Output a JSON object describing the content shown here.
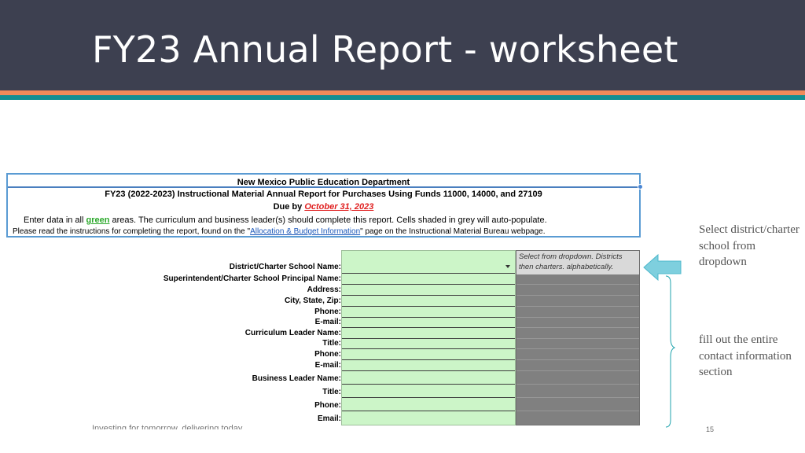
{
  "slide": {
    "title": "FY23 Annual Report - worksheet",
    "footer": "Investing for tomorrow, delivering today.",
    "page_number": "15"
  },
  "sheet": {
    "org": "New Mexico Public Education Department",
    "report_title": "FY23 (2022-2023) Instructional Material Annual Report for Purchases Using Funds 11000, 14000, and 27109",
    "due_prefix": "Due by ",
    "due_date": "October 31, 2023",
    "instr_pre": "Enter data in all ",
    "instr_green": "green",
    "instr_post": " areas.  The curriculum and business leader(s) should complete this report.  Cells shaded in grey will auto-populate.",
    "read_pre": "Please read the instructions for completing the report, found on the \"",
    "read_link": "Allocation & Budget Information",
    "read_post": "\" page on the Instructional Material Bureau webpage.",
    "dropdown_note": "Select from dropdown.  Districts then charters. alphabetically.",
    "fields": [
      "District/Charter School Name:",
      "Superintendent/Charter School Principal Name:",
      "Address:",
      "City, State, Zip:",
      "Phone:",
      "E-mail:",
      "Curriculum Leader Name:",
      "Title:",
      "Phone:",
      "E-mail:",
      "Business Leader Name:",
      "Title:",
      "Phone:",
      "Email:"
    ]
  },
  "callouts": {
    "select": "Select district/charter school from dropdown",
    "contact": "fill out the entire contact information section"
  },
  "colors": {
    "title_bar": "#3d4050",
    "accent_orange": "#f08a5a",
    "accent_teal": "#138e92",
    "entry_green": "#ccf5c8",
    "auto_grey": "#808080",
    "arrow_fill": "#7ecfde"
  }
}
